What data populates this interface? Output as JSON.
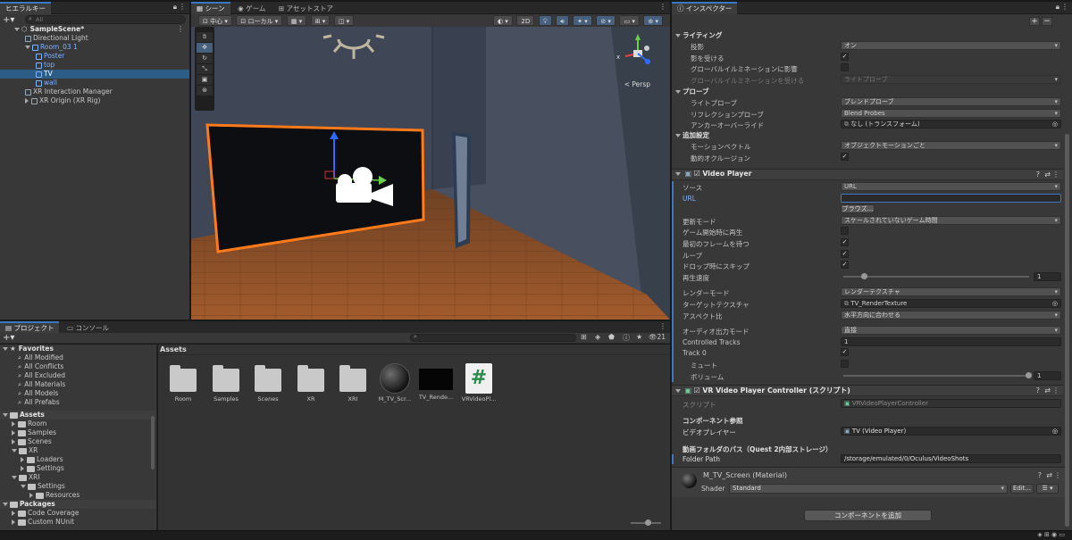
{
  "hierarchy": {
    "tab": "ヒエラルキー",
    "search_placeholder": "All",
    "items": [
      {
        "label": "SampleScene*",
        "depth": 0
      },
      {
        "label": "Directional Light",
        "depth": 1
      },
      {
        "label": "Room_03 1",
        "depth": 1
      },
      {
        "label": "Poster",
        "depth": 2
      },
      {
        "label": "top",
        "depth": 2
      },
      {
        "label": "TV",
        "depth": 2
      },
      {
        "label": "wall",
        "depth": 2
      },
      {
        "label": "XR Interaction Manager",
        "depth": 1
      },
      {
        "label": "XR Origin (XR Rig)",
        "depth": 1
      }
    ]
  },
  "scene": {
    "tabs": [
      "シーン",
      "ゲーム",
      "アセットストア"
    ],
    "toolbar": {
      "pivot": "中心",
      "space": "ローカル",
      "mode2d": "2D"
    },
    "persp": "< Persp",
    "gizmo_axes": [
      "x",
      "y",
      "z"
    ]
  },
  "project": {
    "tabs": [
      "プロジェクト",
      "コンソール"
    ],
    "count": "21",
    "breadcrumb": "Assets",
    "favorites_label": "Favorites",
    "favorites": [
      "All Modified",
      "All Conflicts",
      "All Excluded",
      "All Materials",
      "All Models",
      "All Prefabs"
    ],
    "tree": [
      {
        "label": "Assets",
        "depth": 0,
        "bold": true
      },
      {
        "label": "Room",
        "depth": 1
      },
      {
        "label": "Samples",
        "depth": 1
      },
      {
        "label": "Scenes",
        "depth": 1
      },
      {
        "label": "XR",
        "depth": 1
      },
      {
        "label": "Loaders",
        "depth": 2
      },
      {
        "label": "Settings",
        "depth": 2
      },
      {
        "label": "XRI",
        "depth": 1
      },
      {
        "label": "Settings",
        "depth": 2
      },
      {
        "label": "Resources",
        "depth": 3
      },
      {
        "label": "Packages",
        "depth": 0,
        "bold": true
      },
      {
        "label": "Code Coverage",
        "depth": 1
      },
      {
        "label": "Custom NUnit",
        "depth": 1
      }
    ],
    "assets": [
      {
        "name": "Room",
        "kind": "folder"
      },
      {
        "name": "Samples",
        "kind": "folder"
      },
      {
        "name": "Scenes",
        "kind": "folder"
      },
      {
        "name": "XR",
        "kind": "folder"
      },
      {
        "name": "XRI",
        "kind": "folder"
      },
      {
        "name": "M_TV_Scr...",
        "kind": "material"
      },
      {
        "name": "TV_Rende...",
        "kind": "texture"
      },
      {
        "name": "VRVideoPl...",
        "kind": "script"
      }
    ]
  },
  "inspector": {
    "tab": "インスペクター",
    "lighting": {
      "header": "ライティング",
      "rows": [
        {
          "label": "投影",
          "type": "dropdown",
          "value": "オン"
        },
        {
          "label": "影を受ける",
          "type": "check",
          "value": "✓"
        },
        {
          "label": "グローバルイルミネーションに影響",
          "type": "check",
          "value": ""
        },
        {
          "label": "グローバルイルミネーションを受ける",
          "type": "dropdown",
          "value": "ライトプローブ",
          "disabled": true
        }
      ]
    },
    "probes": {
      "header": "プローブ",
      "rows": [
        {
          "label": "ライトプローブ",
          "type": "dropdown",
          "value": "ブレンドプローブ"
        },
        {
          "label": "リフレクションプローブ",
          "type": "dropdown",
          "value": "Blend Probes"
        },
        {
          "label": "アンカーオーバーライド",
          "type": "object",
          "value": "なし (トランスフォーム)"
        }
      ]
    },
    "additional": {
      "header": "追加設定",
      "rows": [
        {
          "label": "モーションベクトル",
          "type": "dropdown",
          "value": "オブジェクトモーションごと"
        },
        {
          "label": "動的オクルージョン",
          "type": "check",
          "value": "✓"
        }
      ]
    },
    "video_player": {
      "title": "Video Player",
      "rows": [
        {
          "label": "ソース",
          "type": "dropdown",
          "value": "URL"
        },
        {
          "label": "URL",
          "type": "text",
          "value": "",
          "blue": true
        },
        {
          "label": "",
          "type": "button",
          "value": "ブラウズ..."
        },
        {
          "label": "更新モード",
          "type": "dropdown",
          "value": "スケールされていないゲーム時間"
        },
        {
          "label": "ゲーム開始時に再生",
          "type": "check",
          "value": ""
        },
        {
          "label": "最初のフレームを待つ",
          "type": "check",
          "value": "✓"
        },
        {
          "label": "ループ",
          "type": "check",
          "value": "✓"
        },
        {
          "label": "ドロップ時にスキップ",
          "type": "check",
          "value": "✓"
        },
        {
          "label": "再生速度",
          "type": "slider",
          "value": "1",
          "fraction": 0.1
        },
        {
          "label": "",
          "type": "gap",
          "value": ""
        },
        {
          "label": "レンダーモード",
          "type": "dropdown",
          "value": "レンダーテクスチャ"
        },
        {
          "label": "ターゲットテクスチャ",
          "type": "object",
          "value": "TV_RenderTexture"
        },
        {
          "label": "アスペクト比",
          "type": "dropdown",
          "value": "水平方向に合わせる"
        },
        {
          "label": "",
          "type": "gap",
          "value": ""
        },
        {
          "label": "オーディオ出力モード",
          "type": "dropdown",
          "value": "直接"
        },
        {
          "label": "Controlled Tracks",
          "type": "text",
          "value": "1"
        },
        {
          "label": "Track 0",
          "type": "check",
          "value": "✓"
        },
        {
          "label": "ミュート",
          "type": "check",
          "value": "",
          "indent": true
        },
        {
          "label": "ボリューム",
          "type": "slider",
          "value": "1",
          "fraction": 1.0,
          "indent": true
        }
      ]
    },
    "controller": {
      "title": "VR Video Player Controller (スクリプト)",
      "script_label": "スクリプト",
      "script_value": "VRVideoPlayerController",
      "comp_ref_header": "コンポーネント参照",
      "video_player_label": "ビデオプレイヤー",
      "video_player_value": "TV (Video Player)",
      "folder_header": "動画フォルダのパス（Quest 2内部ストレージ）",
      "folder_label": "Folder Path",
      "folder_value": "/storage/emulated/0/Oculus/VideoShots"
    },
    "material": {
      "title": "M_TV_Screen (Material)",
      "shader_label": "Shader",
      "shader_value": "Standard",
      "edit_label": "Edit..."
    },
    "add_component": "コンポーネントを追加"
  }
}
